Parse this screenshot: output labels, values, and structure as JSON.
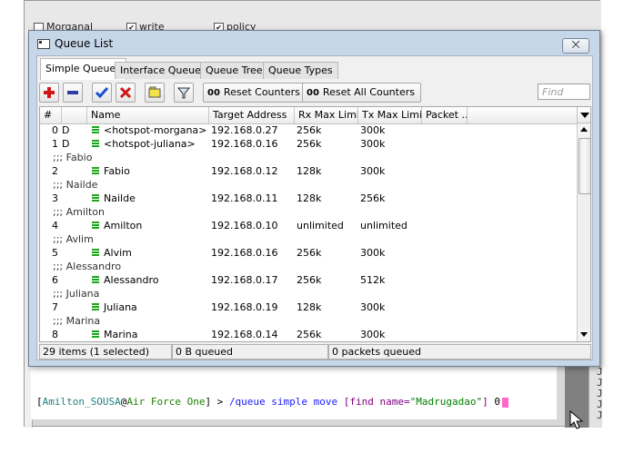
{
  "background": {
    "checkboxes": [
      {
        "label": "Morganal"
      },
      {
        "label": "write"
      },
      {
        "label": "policy"
      }
    ],
    "right_letters": [
      "J",
      "J",
      "J",
      "J",
      "J"
    ]
  },
  "window": {
    "title": "Queue List",
    "close_label": "⨉"
  },
  "tabs": [
    {
      "label": "Simple Queues",
      "active": true
    },
    {
      "label": "Interface Queues",
      "active": false
    },
    {
      "label": "Queue Tree",
      "active": false
    },
    {
      "label": "Queue Types",
      "active": false
    }
  ],
  "toolbar": {
    "icons": [
      "add-icon",
      "remove-icon",
      "enable-check-icon",
      "disable-x-icon",
      "comment-icon",
      "filter-icon"
    ],
    "reset_counters_prefix": "00",
    "reset_counters_label": "Reset Counters",
    "reset_all_counters_prefix": "00",
    "reset_all_counters_label": "Reset All Counters",
    "find_placeholder": "Find"
  },
  "table": {
    "columns": [
      "#",
      "Name",
      "Target Address",
      "Rx Max Limit",
      "Tx Max Limit",
      "Packet ..."
    ],
    "rows": [
      {
        "type": "item",
        "num": "0",
        "flag": "D",
        "name": "<hotspot-morgana>",
        "target": "192.168.0.27",
        "rx": "256k",
        "tx": "300k"
      },
      {
        "type": "item",
        "num": "1",
        "flag": "D",
        "name": "<hotspot-juliana>",
        "target": "192.168.0.16",
        "rx": "256k",
        "tx": "300k"
      },
      {
        "type": "comment",
        "text": ";;; Fabio"
      },
      {
        "type": "item",
        "num": "2",
        "flag": "",
        "name": "Fabio",
        "target": "192.168.0.12",
        "rx": "128k",
        "tx": "300k"
      },
      {
        "type": "comment",
        "text": ";;; Nailde"
      },
      {
        "type": "item",
        "num": "3",
        "flag": "",
        "name": "Nailde",
        "target": "192.168.0.11",
        "rx": "128k",
        "tx": "256k"
      },
      {
        "type": "comment",
        "text": ";;; Amilton"
      },
      {
        "type": "item",
        "num": "4",
        "flag": "",
        "name": "Amilton",
        "target": "192.168.0.10",
        "rx": "unlimited",
        "tx": "unlimited"
      },
      {
        "type": "comment",
        "text": ";;; Avlim"
      },
      {
        "type": "item",
        "num": "5",
        "flag": "",
        "name": "Alvim",
        "target": "192.168.0.16",
        "rx": "256k",
        "tx": "300k"
      },
      {
        "type": "comment",
        "text": ";;; Alessandro"
      },
      {
        "type": "item",
        "num": "6",
        "flag": "",
        "name": "Alessandro",
        "target": "192.168.0.17",
        "rx": "256k",
        "tx": "512k"
      },
      {
        "type": "comment",
        "text": ";;; Juliana"
      },
      {
        "type": "item",
        "num": "7",
        "flag": "",
        "name": "Juliana",
        "target": "192.168.0.19",
        "rx": "128k",
        "tx": "300k"
      },
      {
        "type": "comment",
        "text": ";;; Marina"
      },
      {
        "type": "item",
        "num": "8",
        "flag": "",
        "name": "Marina",
        "target": "192.168.0.14",
        "rx": "256k",
        "tx": "300k"
      }
    ]
  },
  "status": {
    "items": "29 items (1 selected)",
    "queued": "0 B queued",
    "packets": "0 packets queued"
  },
  "terminal": {
    "bracket_open": "[",
    "user": "Amilton_SOUSA",
    "at": "@",
    "host": "Air Force One",
    "bracket_close": "] > ",
    "command": "/queue simple move ",
    "find_open": "[find name=",
    "find_value": "\"Madrugadao\"",
    "find_close": "] ",
    "argument": "0"
  },
  "colors": {
    "dialog_frame": "#c7d7ea",
    "queue_icon": "#1aa81a",
    "add_red": "#d01818",
    "terminal_user": "#208080",
    "terminal_host": "#208000",
    "terminal_cmd": "#1a1aff",
    "terminal_keyword": "#800080",
    "terminal_cursor": "#ff66cc"
  }
}
